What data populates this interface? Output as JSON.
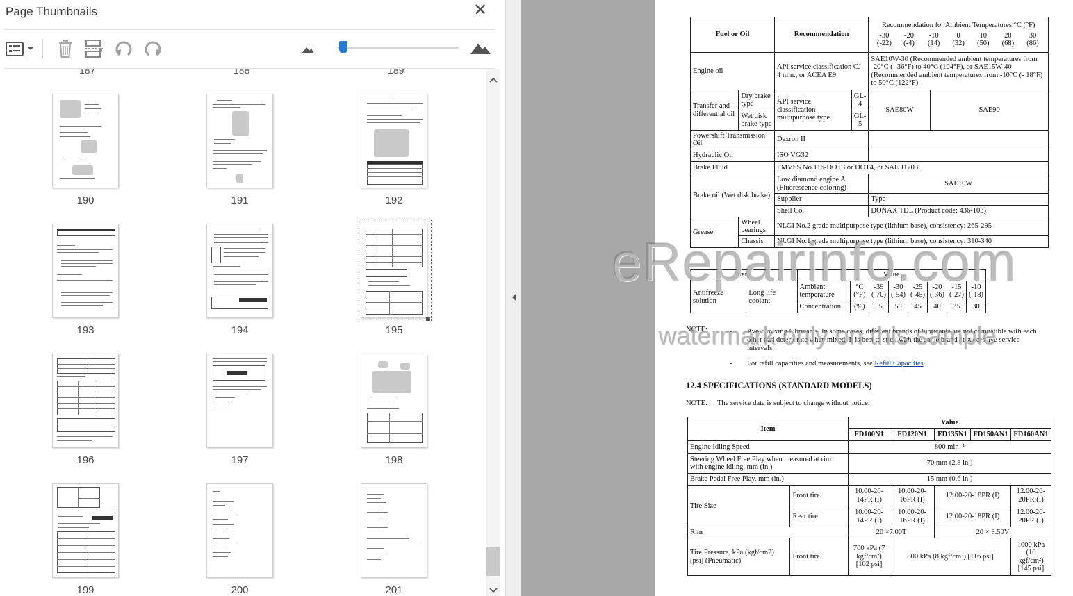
{
  "panel": {
    "title": "Page Thumbnails",
    "close_glyph": "✕",
    "top_row_labels": [
      "187",
      "188",
      "189"
    ],
    "thumbnails": [
      {
        "page": "190"
      },
      {
        "page": "191"
      },
      {
        "page": "192"
      },
      {
        "page": "193"
      },
      {
        "page": "194"
      },
      {
        "page": "195",
        "selected": true
      },
      {
        "page": "196"
      },
      {
        "page": "197"
      },
      {
        "page": "198"
      },
      {
        "page": "199"
      },
      {
        "page": "200"
      },
      {
        "page": "201"
      }
    ],
    "toolbar_icons": [
      "thumbnail-options-icon",
      "delete-icon",
      "insert-page-icon",
      "rotate-left-icon",
      "rotate-right-icon",
      "zoom-out-mountain-icon",
      "zoom-in-mountain-icon"
    ],
    "zoom_level": 0.05
  },
  "doc": {
    "lube": {
      "h_fuel": "Fuel or Oil",
      "h_rec": "Recommendation",
      "h_amb": "Recommendation for Ambient Temperatures °C (°F)",
      "temps": [
        {
          "c": "-30",
          "f": "(-22)"
        },
        {
          "c": "-20",
          "f": "(-4)"
        },
        {
          "c": "-10",
          "f": "(14)"
        },
        {
          "c": "0",
          "f": "(32)"
        },
        {
          "c": "10",
          "f": "(50)"
        },
        {
          "c": "20",
          "f": "(68)"
        },
        {
          "c": "30",
          "f": "(86)"
        }
      ],
      "engine_oil": "Engine oil",
      "engine_rec": "API service classification CJ-4 min., or ACEA E9",
      "engine_amb": "SAE10W-30 (Recommended ambient temperatures from -20°C (- 36°F) to 40°C (104°F), or SAE15W-40 (Recommended ambient temperatures from -10°C (- 18°F) to 50°C (122°F)",
      "transfer": "Transfer and differential oil",
      "dry_brake": "Dry brake type",
      "wet_disk": "Wet disk brake type",
      "api_multi": "API service classification multipurpose type",
      "gl4": "GL-4",
      "gl5": "GL-5",
      "sae80w": "SAE80W",
      "sae90": "SAE90",
      "powershift": "Powershift Transmission Oil",
      "dexron": "Dexron II",
      "hydraulic": "Hydraulic Oil",
      "iso": "ISO VG32",
      "brake_fluid": "Brake Fluid",
      "fmvss": "FMVSS No.116-DOT3 or DOT4, or SAE J1703",
      "brake_oil": "Brake oil (Wet disk brake)",
      "low_diamond": "Low diamond engine A (Fluorescence coloring)",
      "sae10w": "SAE10W",
      "supplier": "Supplier",
      "type": "Type",
      "shell": "Shell Co.",
      "donax": "DONAX TDL (Product code: 436-103)",
      "grease": "Grease",
      "wheel_bearings": "Wheel bearings",
      "chassis": "Chassis",
      "nlgi2": "NLGI No.2 grade multipurpose type (lithium base), consistency: 265-295",
      "nlgi1": "NLGI No.1 grade multipurpose type (lithium base), consistency: 310-340"
    },
    "antifreeze": {
      "item": "Item",
      "value": "Value",
      "antifreeze_solution": "Antifreeze solution",
      "long_life": "Long life coolant",
      "ambient": "Ambient temperature",
      "unit_c": "°C",
      "unit_f": "(°F)",
      "concentration": "Concentration",
      "unit_pct": "(%)",
      "cols": [
        {
          "c": "-39",
          "f": "(-70)",
          "pct": "55"
        },
        {
          "c": "-30",
          "f": "(-54)",
          "pct": "50"
        },
        {
          "c": "-25",
          "f": "(-45)",
          "pct": "45"
        },
        {
          "c": "-20",
          "f": "(-36)",
          "pct": "40"
        },
        {
          "c": "-15",
          "f": "(-27)",
          "pct": "35"
        },
        {
          "c": "-10",
          "f": "(-18)",
          "pct": "30"
        }
      ]
    },
    "note_label": "NOTE:",
    "note1": "Avoid mixing lubricants. In some cases, different brands of lubricants are not compatible with each other and deteriorate when mixed. It is best to stick with the same brand at successive service intervals.",
    "note2_prefix": "For refill capacities and measurements, see",
    "note2_link": "Refill Capacities",
    "note2_suffix": ".",
    "section_heading": "12.4  SPECIFICATIONS (STANDARD MODELS)",
    "note3_label": "NOTE:",
    "note3": "The service data is subject to change without notice.",
    "spec": {
      "item": "Item",
      "value": "Value",
      "models": [
        "FD100N1",
        "FD120N1",
        "FD135N1",
        "FD150AN1",
        "FD160AN1"
      ],
      "idling": "Engine Idling Speed",
      "idling_val": "800 min⁻¹",
      "steering": "Steering Wheel Free Play when measured at rim with engine idling, mm (in.)",
      "steering_val": "70 mm (2.8 in.)",
      "pedal": "Brake Pedal Free Play, mm (in.)",
      "pedal_val": "15 mm (0.6 in.)",
      "tire_size": "Tire Size",
      "front_tire": "Front tire",
      "rear_tire": "Rear tire",
      "t1": "10.00-20-14PR (I)",
      "t2": "10.00-20-16PR (I)",
      "t3": "12.00-20-18PR (I)",
      "t4": "12.00-20-20PR (I)",
      "rim": "Rim",
      "rim1": "20 ×7.00T",
      "rim2": "20 × 8.50V",
      "pressure": "Tire Pressure, kPa (kgf/cm2) [psi] (Pneumatic)",
      "p1": "700 kPa (7 kgf/cm²) [102 psi]",
      "p2": "800 kPa (8 kgf/cm²) [116 psi]",
      "p3": "1000 kPa (10 kgf/cm²) [145 psi]"
    },
    "watermark_main": "eRepairinfo.com",
    "watermark_sub": "watermark only on this sample"
  }
}
